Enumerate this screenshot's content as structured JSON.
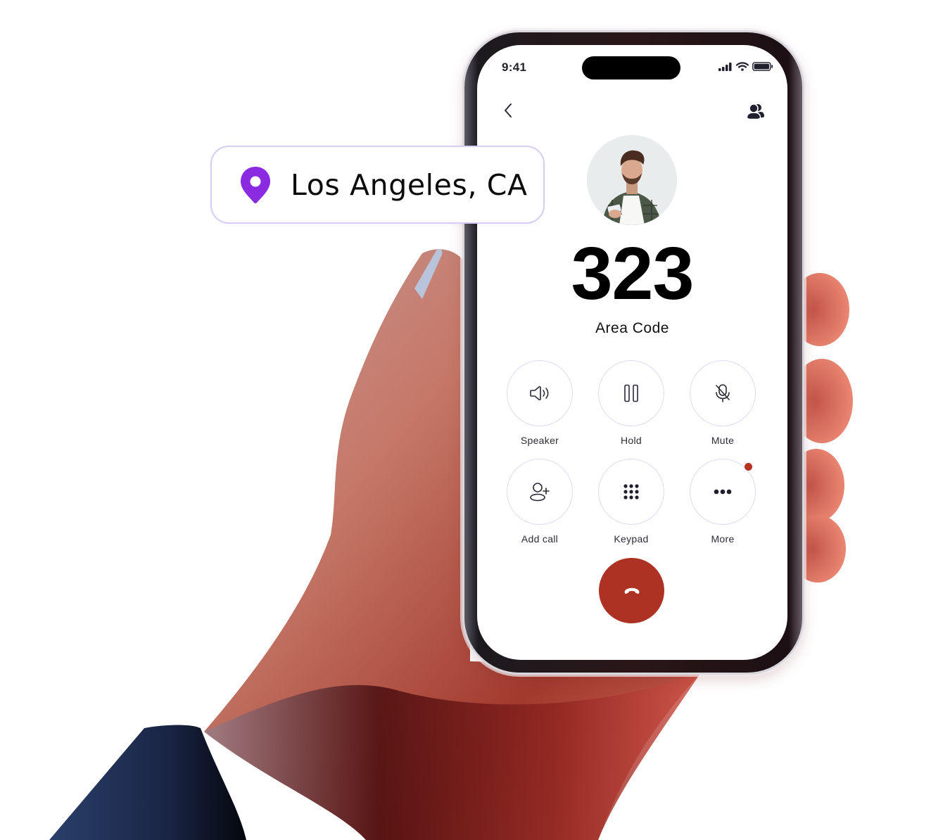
{
  "status_bar": {
    "time": "9:41",
    "icons": [
      "signal-icon",
      "wifi-icon",
      "battery-icon"
    ]
  },
  "nav": {
    "back_icon": "chevron-left-icon",
    "contacts_icon": "contacts-icon"
  },
  "caller": {
    "avatar": "man-with-phone-photo",
    "number": "323",
    "label": "Area Code"
  },
  "controls": [
    {
      "id": "speaker",
      "label": "Speaker",
      "icon": "speaker-icon"
    },
    {
      "id": "hold",
      "label": "Hold",
      "icon": "pause-icon"
    },
    {
      "id": "mute",
      "label": "Mute",
      "icon": "mic-off-icon"
    },
    {
      "id": "add-call",
      "label": "Add call",
      "icon": "add-person-icon"
    },
    {
      "id": "keypad",
      "label": "Keypad",
      "icon": "keypad-icon"
    },
    {
      "id": "more",
      "label": "More",
      "icon": "more-dots-icon",
      "has_notification": true
    }
  ],
  "end_call": {
    "icon": "hang-up-icon"
  },
  "location": {
    "icon": "map-pin-icon",
    "text": "Los Angeles, CA"
  },
  "colors": {
    "accent_purple": "#8a2be2",
    "end_call_red": "#ad3223",
    "notification_red": "#b83222",
    "control_border": "#dcdcf6",
    "pill_border": "#d6ccf5",
    "icon_dark": "#1f1f2e"
  }
}
